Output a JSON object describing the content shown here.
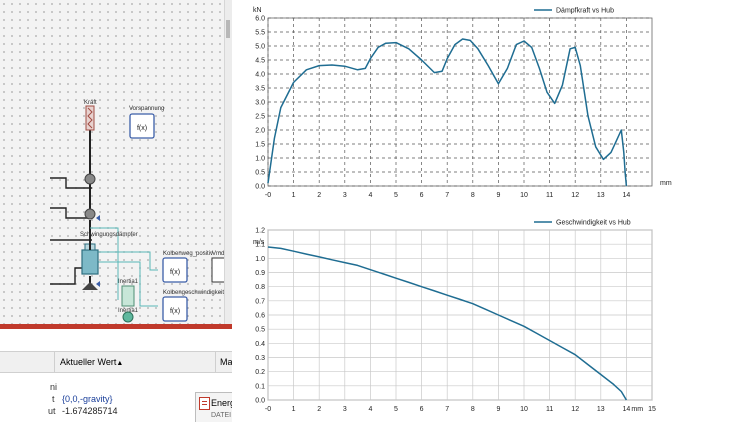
{
  "diagram": {
    "blocks": [
      {
        "id": "vorspannung",
        "label": "Vorspannung",
        "func": "f(x)"
      },
      {
        "id": "kolbenweg",
        "label": "Kolbenweg_positiv",
        "func": "f(x)"
      },
      {
        "id": "kolbengeschw",
        "label": "Kolbengeschwindigkeit_positiv",
        "func": "f(x)"
      },
      {
        "id": "inertia",
        "label": "Inertia1",
        "sublabel": "Inertia1"
      },
      {
        "id": "schwingungsdaempfer",
        "label": "Schwingungsdämpfer"
      },
      {
        "id": "mb",
        "label": "Mb"
      },
      {
        "id": "kraft",
        "label": "Kraft"
      },
      {
        "id": "vmdaten",
        "label": "Vmdaten"
      }
    ]
  },
  "properties": {
    "header_col1": "Aktueller Wert",
    "sort_arrow": "▲",
    "header_col2": "Ma",
    "rows": [
      {
        "key": "ni",
        "value": ""
      },
      {
        "key": "t",
        "value": "{0,0,-gravity}"
      },
      {
        "key": "ut",
        "value": "-1.674285714"
      }
    ]
  },
  "energy_tab": {
    "label": "Energ",
    "sublabel": "DATEI"
  },
  "chart_data": [
    {
      "type": "line",
      "title": "",
      "legend": "Dämpfkraft vs Hub",
      "legend_position": "top-right",
      "ylabel": "kN",
      "xlabel": "mm",
      "xlim": [
        0,
        15
      ],
      "ylim": [
        0,
        6
      ],
      "xticks": [
        "-0",
        "1",
        "2",
        "3",
        "4",
        "5",
        "6",
        "7",
        "8",
        "9",
        "10",
        "11",
        "12",
        "13",
        "14"
      ],
      "yticks": [
        "0.0",
        "0.5",
        "1.0",
        "1.5",
        "2.0",
        "2.5",
        "3.0",
        "3.5",
        "4.0",
        "4.5",
        "5.0",
        "5.5",
        "6.0"
      ],
      "grid": "dashed",
      "color": "#1f6d92",
      "x": [
        0,
        0.25,
        0.5,
        1,
        1.5,
        2,
        2.5,
        3,
        3.5,
        3.8,
        4,
        4.3,
        4.6,
        5,
        5.5,
        6,
        6.5,
        6.8,
        7,
        7.3,
        7.6,
        7.9,
        8.2,
        8.6,
        9,
        9.35,
        9.7,
        10,
        10.3,
        10.6,
        10.9,
        11.2,
        11.5,
        11.8,
        12,
        12.2,
        12.5,
        12.8,
        13.1,
        13.4,
        13.6,
        13.8,
        13.9,
        13.95,
        14.0
      ],
      "y": [
        0.1,
        1.7,
        2.8,
        3.7,
        4.15,
        4.3,
        4.32,
        4.28,
        4.15,
        4.2,
        4.55,
        4.95,
        5.1,
        5.12,
        4.9,
        4.5,
        4.05,
        4.1,
        4.55,
        5.05,
        5.25,
        5.2,
        4.9,
        4.3,
        3.65,
        4.2,
        5.05,
        5.18,
        4.95,
        4.2,
        3.35,
        2.95,
        3.6,
        4.9,
        4.95,
        4.3,
        2.5,
        1.4,
        0.95,
        1.2,
        1.6,
        2.0,
        1.2,
        0.5,
        0.0
      ]
    },
    {
      "type": "line",
      "title": "",
      "legend": "Geschwindigkeit vs Hub",
      "legend_position": "top-right",
      "ylabel": "m/s",
      "xlabel": "mm",
      "xlim": [
        0,
        15
      ],
      "ylim": [
        0,
        1.2
      ],
      "xticks": [
        "-0",
        "1",
        "2",
        "3",
        "4",
        "5",
        "6",
        "7",
        "8",
        "9",
        "10",
        "11",
        "12",
        "13",
        "14",
        "15"
      ],
      "yticks": [
        "0.0",
        "0.1",
        "0.2",
        "0.3",
        "0.4",
        "0.5",
        "0.6",
        "0.7",
        "0.8",
        "0.9",
        "1.0",
        "1.1",
        "1.2"
      ],
      "grid": "solid",
      "color": "#1f6d92",
      "x": [
        0,
        0.5,
        1,
        1.5,
        2,
        2.5,
        3,
        3.5,
        4,
        4.5,
        5,
        5.5,
        6,
        6.5,
        7,
        7.5,
        8,
        8.5,
        9,
        9.5,
        10,
        10.5,
        11,
        11.5,
        12,
        12.5,
        13,
        13.5,
        13.8,
        14.0
      ],
      "y": [
        1.08,
        1.07,
        1.05,
        1.03,
        1.01,
        0.99,
        0.97,
        0.95,
        0.92,
        0.89,
        0.86,
        0.83,
        0.8,
        0.77,
        0.74,
        0.71,
        0.68,
        0.64,
        0.6,
        0.56,
        0.52,
        0.47,
        0.42,
        0.37,
        0.32,
        0.25,
        0.18,
        0.11,
        0.06,
        0.0
      ]
    }
  ]
}
